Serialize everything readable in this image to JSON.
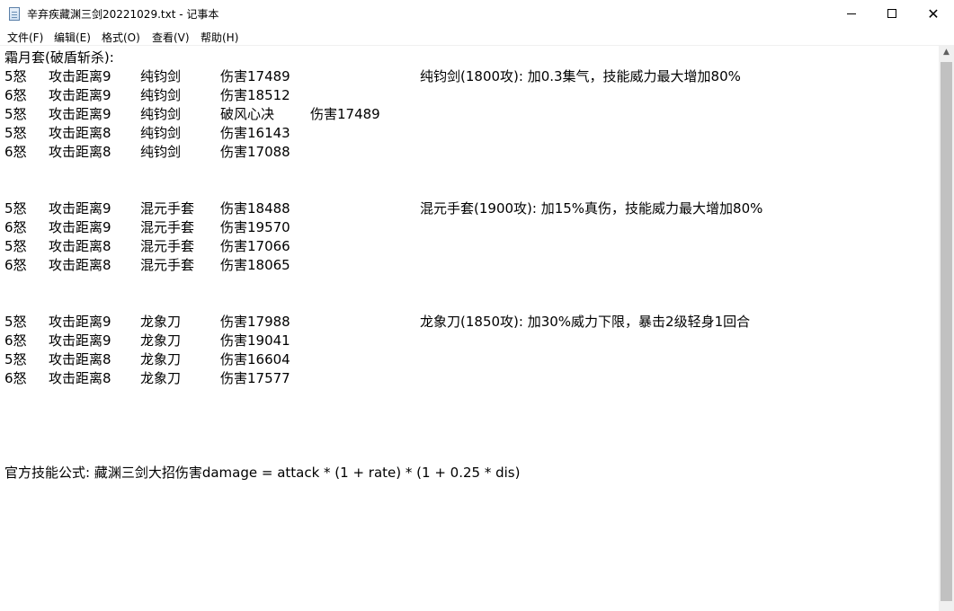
{
  "window": {
    "title": "辛弃疾藏渊三剑20221029.txt - 记事本"
  },
  "menu": [
    "文件(F)",
    "编辑(E)",
    "格式(O)",
    "查看(V)",
    "帮助(H)"
  ],
  "lines": {
    "header": "霜月套(破盾斩杀):",
    "r1": [
      "5怒",
      "攻击距离9",
      "纯钧剑",
      "伤害17489"
    ],
    "n1": "纯钧剑(1800攻):      加0.3集气，技能威力最大增加80%",
    "r2": [
      "6怒",
      "攻击距离9",
      "纯钧剑",
      "伤害18512"
    ],
    "r3": [
      "5怒",
      "攻击距离9",
      "纯钧剑",
      "破风心决",
      "伤害17489"
    ],
    "r4": [
      "5怒",
      "攻击距离8",
      "纯钧剑",
      "伤害16143"
    ],
    "r5": [
      "6怒",
      "攻击距离8",
      "纯钧剑",
      "伤害17088"
    ],
    "r6": [
      "5怒",
      "攻击距离9",
      "混元手套",
      "伤害18488"
    ],
    "n2": "混元手套(1900攻):  加15%真伤，技能威力最大增加80%",
    "r7": [
      "6怒",
      "攻击距离9",
      "混元手套",
      "伤害19570"
    ],
    "r8": [
      "5怒",
      "攻击距离8",
      "混元手套",
      "伤害17066"
    ],
    "r9": [
      "6怒",
      "攻击距离8",
      "混元手套",
      "伤害18065"
    ],
    "r10": [
      "5怒",
      "攻击距离9",
      "龙象刀",
      "伤害17988"
    ],
    "n3": "龙象刀(1850攻):     加30%威力下限，暴击2级轻身1回合",
    "r11": [
      "6怒",
      "攻击距离9",
      "龙象刀",
      "伤害19041"
    ],
    "r12": [
      "5怒",
      "攻击距离8",
      "龙象刀",
      "伤害16604"
    ],
    "r13": [
      "6怒",
      "攻击距离8",
      "龙象刀",
      "伤害17577"
    ],
    "formula": "官方技能公式:  藏渊三剑大招伤害damage = attack * (1 + rate) * (1 + 0.25 * dis)"
  },
  "icons": {
    "app": "notepad-icon",
    "minimize": "minimize-icon",
    "maximize": "maximize-icon",
    "close": "close-icon",
    "scroll_up": "scroll-up-arrow-icon"
  }
}
